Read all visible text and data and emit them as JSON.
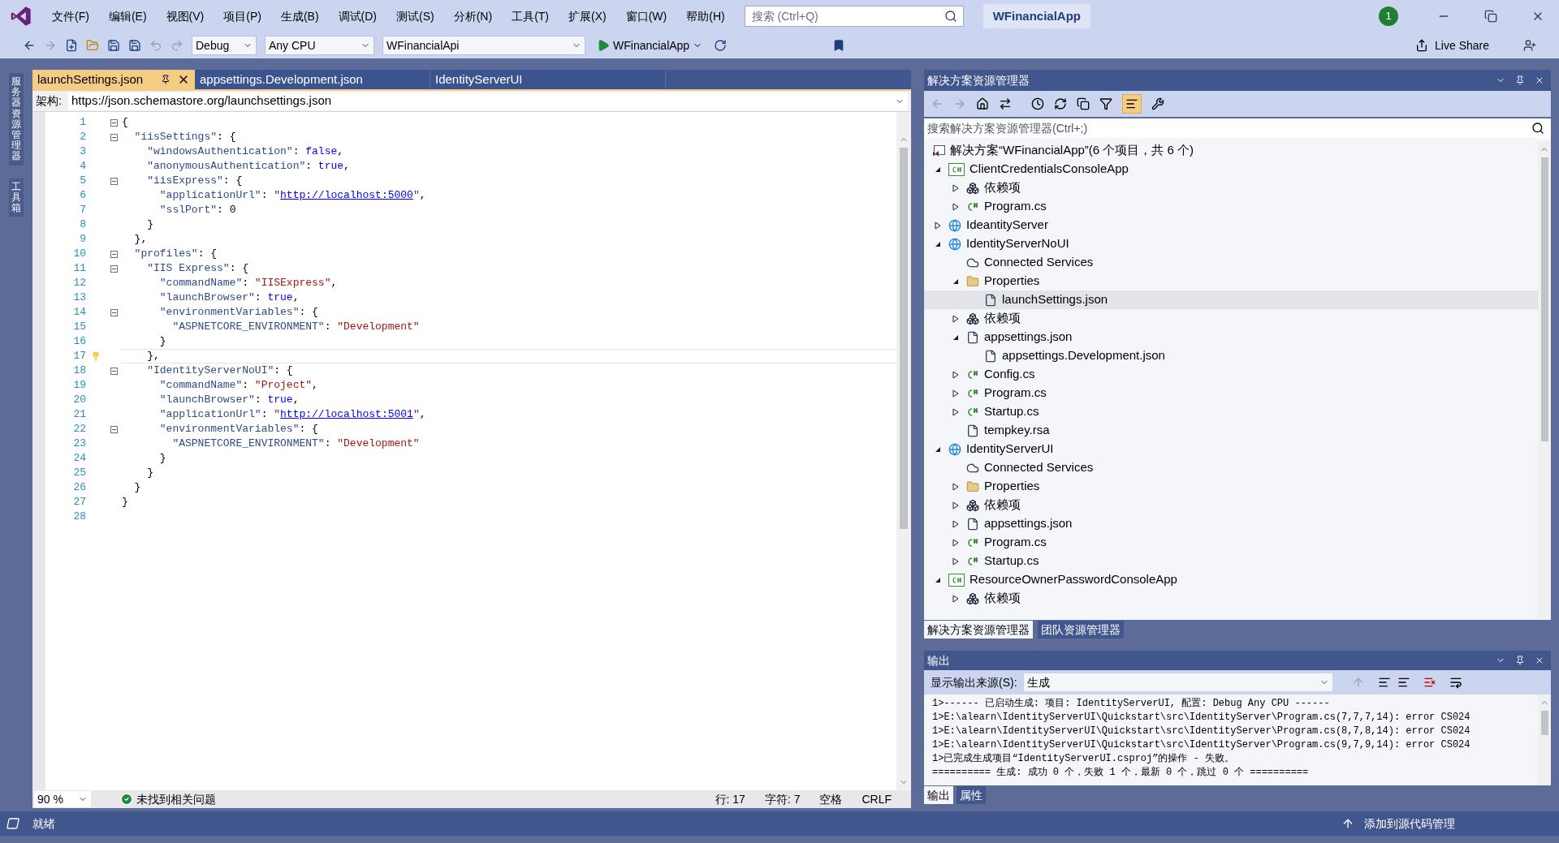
{
  "window": {
    "title": "WFinancialApp",
    "notification_count": "1"
  },
  "menu": [
    "文件(F)",
    "编辑(E)",
    "视图(V)",
    "项目(P)",
    "生成(B)",
    "调试(D)",
    "测试(S)",
    "分析(N)",
    "工具(T)",
    "扩展(X)",
    "窗口(W)",
    "帮助(H)"
  ],
  "search": {
    "placeholder": "搜索 (Ctrl+Q)"
  },
  "toolbar": {
    "configuration": "Debug",
    "platform": "Any CPU",
    "startup_project": "WFinancialApi",
    "run_target": "WFinancialApp",
    "live_share": "Live Share"
  },
  "side_tabs": [
    "服务器资源管理器",
    "工具箱"
  ],
  "editor": {
    "tabs": [
      {
        "label": "launchSettings.json",
        "selected": true
      },
      {
        "label": "appsettings.Development.json",
        "selected": false
      },
      {
        "label": "IdentityServerUI",
        "selected": false
      }
    ],
    "schema_label": "架构:",
    "schema_url": "https://json.schemastore.org/launchsettings.json",
    "lines": [
      {
        "n": "1",
        "fold": true,
        "current": false,
        "tokens": [
          {
            "t": "{",
            "kind": "punct"
          }
        ]
      },
      {
        "n": "2",
        "fold": true,
        "current": false,
        "tokens": [
          {
            "t": "  \"iisSettings\"",
            "kind": "key"
          },
          {
            "t": ": {",
            "kind": "punct"
          }
        ]
      },
      {
        "n": "3",
        "fold": false,
        "current": false,
        "tokens": [
          {
            "t": "    \"windowsAuthentication\"",
            "kind": "key"
          },
          {
            "t": ": ",
            "kind": "punct"
          },
          {
            "t": "false",
            "kind": "keyword"
          },
          {
            "t": ",",
            "kind": "punct"
          }
        ]
      },
      {
        "n": "4",
        "fold": false,
        "current": false,
        "tokens": [
          {
            "t": "    \"anonymousAuthentication\"",
            "kind": "key"
          },
          {
            "t": ": ",
            "kind": "punct"
          },
          {
            "t": "true",
            "kind": "keyword"
          },
          {
            "t": ",",
            "kind": "punct"
          }
        ]
      },
      {
        "n": "5",
        "fold": true,
        "current": false,
        "tokens": [
          {
            "t": "    \"iisExpress\"",
            "kind": "key"
          },
          {
            "t": ": {",
            "kind": "punct"
          }
        ]
      },
      {
        "n": "6",
        "fold": false,
        "current": false,
        "tokens": [
          {
            "t": "      \"applicationUrl\"",
            "kind": "key"
          },
          {
            "t": ": ",
            "kind": "punct"
          },
          {
            "t": "\"",
            "kind": "string"
          },
          {
            "t": "http://localhost:5000",
            "kind": "link"
          },
          {
            "t": "\"",
            "kind": "string"
          },
          {
            "t": ",",
            "kind": "punct"
          }
        ]
      },
      {
        "n": "7",
        "fold": false,
        "current": false,
        "tokens": [
          {
            "t": "      \"sslPort\"",
            "kind": "key"
          },
          {
            "t": ": 0",
            "kind": "punct"
          }
        ]
      },
      {
        "n": "8",
        "fold": false,
        "current": false,
        "tokens": [
          {
            "t": "    }",
            "kind": "punct"
          }
        ]
      },
      {
        "n": "9",
        "fold": false,
        "current": false,
        "tokens": [
          {
            "t": "  },",
            "kind": "punct"
          }
        ]
      },
      {
        "n": "10",
        "fold": true,
        "current": false,
        "tokens": [
          {
            "t": "  \"profiles\"",
            "kind": "key"
          },
          {
            "t": ": {",
            "kind": "punct"
          }
        ]
      },
      {
        "n": "11",
        "fold": true,
        "current": false,
        "tokens": [
          {
            "t": "    \"IIS Express\"",
            "kind": "key"
          },
          {
            "t": ": {",
            "kind": "punct"
          }
        ]
      },
      {
        "n": "12",
        "fold": false,
        "current": false,
        "tokens": [
          {
            "t": "      \"commandName\"",
            "kind": "key"
          },
          {
            "t": ": ",
            "kind": "punct"
          },
          {
            "t": "\"IISExpress\"",
            "kind": "string"
          },
          {
            "t": ",",
            "kind": "punct"
          }
        ]
      },
      {
        "n": "13",
        "fold": false,
        "current": false,
        "tokens": [
          {
            "t": "      \"launchBrowser\"",
            "kind": "key"
          },
          {
            "t": ": ",
            "kind": "punct"
          },
          {
            "t": "true",
            "kind": "keyword"
          },
          {
            "t": ",",
            "kind": "punct"
          }
        ]
      },
      {
        "n": "14",
        "fold": true,
        "current": false,
        "tokens": [
          {
            "t": "      \"environmentVariables\"",
            "kind": "key"
          },
          {
            "t": ": {",
            "kind": "punct"
          }
        ]
      },
      {
        "n": "15",
        "fold": false,
        "current": false,
        "tokens": [
          {
            "t": "        \"ASPNETCORE_ENVIRONMENT\"",
            "kind": "key"
          },
          {
            "t": ": ",
            "kind": "punct"
          },
          {
            "t": "\"Development\"",
            "kind": "string"
          }
        ]
      },
      {
        "n": "16",
        "fold": false,
        "current": false,
        "tokens": [
          {
            "t": "      }",
            "kind": "punct"
          }
        ]
      },
      {
        "n": "17",
        "fold": false,
        "current": true,
        "tokens": [
          {
            "t": "    },",
            "kind": "punct"
          }
        ]
      },
      {
        "n": "18",
        "fold": true,
        "current": false,
        "tokens": [
          {
            "t": "    \"IdentityServerNoUI\"",
            "kind": "key"
          },
          {
            "t": ": {",
            "kind": "punct"
          }
        ]
      },
      {
        "n": "19",
        "fold": false,
        "current": false,
        "tokens": [
          {
            "t": "      \"commandName\"",
            "kind": "key"
          },
          {
            "t": ": ",
            "kind": "punct"
          },
          {
            "t": "\"Project\"",
            "kind": "string"
          },
          {
            "t": ",",
            "kind": "punct"
          }
        ]
      },
      {
        "n": "20",
        "fold": false,
        "current": false,
        "tokens": [
          {
            "t": "      \"launchBrowser\"",
            "kind": "key"
          },
          {
            "t": ": ",
            "kind": "punct"
          },
          {
            "t": "true",
            "kind": "keyword"
          },
          {
            "t": ",",
            "kind": "punct"
          }
        ]
      },
      {
        "n": "21",
        "fold": false,
        "current": false,
        "tokens": [
          {
            "t": "      \"applicationUrl\"",
            "kind": "key"
          },
          {
            "t": ": ",
            "kind": "punct"
          },
          {
            "t": "\"",
            "kind": "string"
          },
          {
            "t": "http://localhost:5001",
            "kind": "link"
          },
          {
            "t": "\"",
            "kind": "string"
          },
          {
            "t": ",",
            "kind": "punct"
          }
        ]
      },
      {
        "n": "22",
        "fold": true,
        "current": false,
        "tokens": [
          {
            "t": "      \"environmentVariables\"",
            "kind": "key"
          },
          {
            "t": ": {",
            "kind": "punct"
          }
        ]
      },
      {
        "n": "23",
        "fold": false,
        "current": false,
        "tokens": [
          {
            "t": "        \"ASPNETCORE_ENVIRONMENT\"",
            "kind": "key"
          },
          {
            "t": ": ",
            "kind": "punct"
          },
          {
            "t": "\"Development\"",
            "kind": "string"
          }
        ]
      },
      {
        "n": "24",
        "fold": false,
        "current": false,
        "tokens": [
          {
            "t": "      }",
            "kind": "punct"
          }
        ]
      },
      {
        "n": "25",
        "fold": false,
        "current": false,
        "tokens": [
          {
            "t": "    }",
            "kind": "punct"
          }
        ]
      },
      {
        "n": "26",
        "fold": false,
        "current": false,
        "tokens": [
          {
            "t": "  }",
            "kind": "punct"
          }
        ]
      },
      {
        "n": "27",
        "fold": false,
        "current": false,
        "tokens": [
          {
            "t": "}",
            "kind": "punct"
          }
        ]
      },
      {
        "n": "28",
        "fold": false,
        "current": false
      }
    ],
    "zoom": "90 %",
    "issues": "未找到相关问题",
    "status": [
      "行: 17",
      "字符: 7",
      "空格",
      "CRLF"
    ]
  },
  "solution_explorer": {
    "title": "解决方案资源管理器",
    "search_placeholder": "搜索解决方案资源管理器(Ctrl+;)",
    "tree": [
      {
        "label": "解决方案“WFinancialApp”(6 个项目，共 6 个)",
        "kind": "solution",
        "selected": false,
        "children": [
          {
            "label": "ClientCredentialsConsoleApp",
            "kind": "csproj",
            "expanded": true,
            "selected": false,
            "children": [
              {
                "label": "依赖项",
                "kind": "deps",
                "expanded": false,
                "selected": false
              },
              {
                "label": "Program.cs",
                "kind": "cs",
                "expanded": false,
                "selected": false
              }
            ]
          },
          {
            "label": "IdeantityServer",
            "kind": "web",
            "expanded": false,
            "selected": false
          },
          {
            "label": "IdentityServerNoUI",
            "kind": "web",
            "expanded": true,
            "selected": false,
            "children": [
              {
                "label": "Connected Services",
                "kind": "connected",
                "selected": false
              },
              {
                "label": "Properties",
                "kind": "folder",
                "expanded": true,
                "selected": false,
                "children": [
                  {
                    "label": "launchSettings.json",
                    "kind": "json",
                    "selected": true
                  }
                ]
              },
              {
                "label": "依赖项",
                "kind": "deps",
                "expanded": false,
                "selected": false
              },
              {
                "label": "appsettings.json",
                "kind": "json",
                "expanded": true,
                "selected": false,
                "children": [
                  {
                    "label": "appsettings.Development.json",
                    "kind": "json",
                    "selected": false
                  }
                ]
              },
              {
                "label": "Config.cs",
                "kind": "cs",
                "expanded": false,
                "selected": false
              },
              {
                "label": "Program.cs",
                "kind": "cs",
                "expanded": false,
                "selected": false
              },
              {
                "label": "Startup.cs",
                "kind": "cs",
                "expanded": false,
                "selected": false
              },
              {
                "label": "tempkey.rsa",
                "kind": "file",
                "selected": false
              }
            ]
          },
          {
            "label": "IdentityServerUI",
            "kind": "web",
            "expanded": true,
            "selected": false,
            "children": [
              {
                "label": "Connected Services",
                "kind": "connected",
                "selected": false
              },
              {
                "label": "Properties",
                "kind": "folder",
                "expanded": false,
                "selected": false
              },
              {
                "label": "依赖项",
                "kind": "deps",
                "expanded": false,
                "selected": false
              },
              {
                "label": "appsettings.json",
                "kind": "json",
                "expanded": false,
                "selected": false
              },
              {
                "label": "Program.cs",
                "kind": "cs",
                "expanded": false,
                "selected": false
              },
              {
                "label": "Startup.cs",
                "kind": "cs",
                "expanded": false,
                "selected": false
              }
            ]
          },
          {
            "label": "ResourceOwnerPasswordConsoleApp",
            "kind": "csproj",
            "expanded": true,
            "selected": false,
            "children": [
              {
                "label": "依赖项",
                "kind": "deps",
                "expanded": false,
                "selected": false
              }
            ]
          }
        ]
      }
    ],
    "tabs": [
      {
        "label": "解决方案资源管理器",
        "selected": true
      },
      {
        "label": "团队资源管理器",
        "selected": false
      }
    ]
  },
  "output": {
    "title": "输出",
    "source_label": "显示输出来源(S):",
    "source": "生成",
    "lines": [
      "1>------ 已启动生成: 项目: IdentityServerUI, 配置: Debug Any CPU ------",
      "1>E:\\alearn\\IdentityServerUI\\Quickstart\\src\\IdentityServer\\Program.cs(7,7,7,14): error CS024",
      "1>E:\\alearn\\IdentityServerUI\\Quickstart\\src\\IdentityServer\\Program.cs(8,7,8,14): error CS024",
      "1>E:\\alearn\\IdentityServerUI\\Quickstart\\src\\IdentityServer\\Program.cs(9,7,9,14): error CS024",
      "1>已完成生成项目“IdentityServerUI.csproj”的操作 - 失败。",
      "========== 生成: 成功 0 个，失败 1 个，最新 0 个，跳过 0 个 =========="
    ],
    "tabs": [
      {
        "label": "输出",
        "selected": true
      },
      {
        "label": "属性",
        "selected": false
      }
    ]
  },
  "status_bar": {
    "text": "就绪",
    "source_control": "添加到源代码管理"
  }
}
